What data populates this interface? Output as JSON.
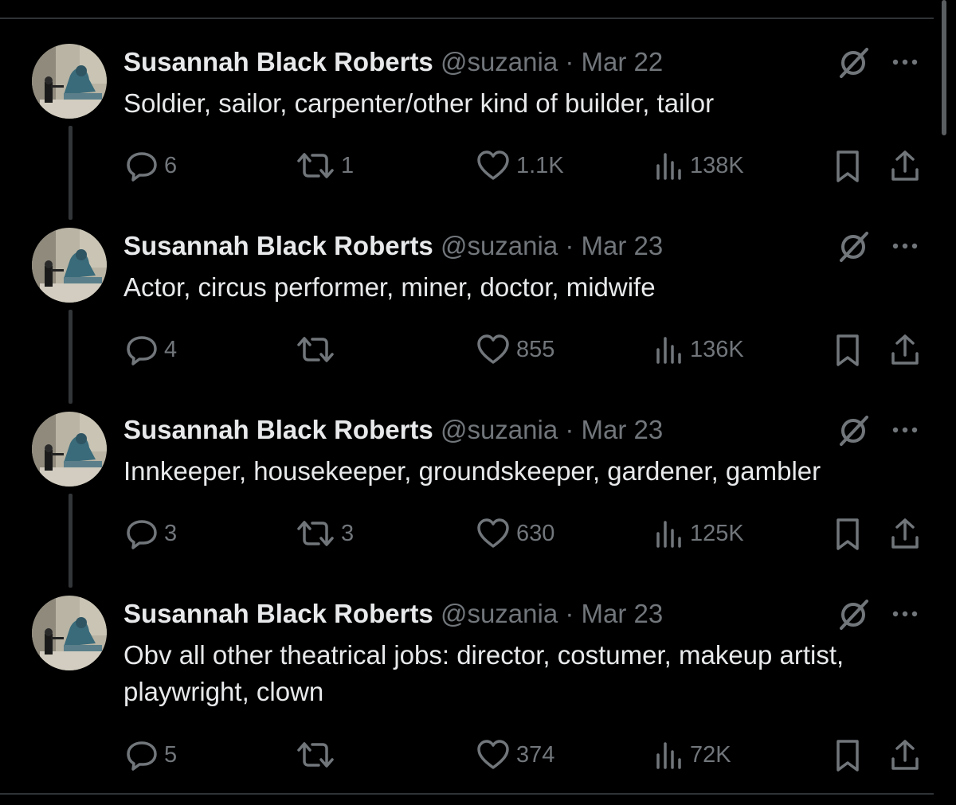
{
  "colors": {
    "background": "#000000",
    "primary_text": "#e7e9ea",
    "secondary_text": "#71767b",
    "divider": "#2f3336"
  },
  "tweets": [
    {
      "display_name": "Susannah Black Roberts",
      "handle": "@suzania",
      "separator": "·",
      "date": "Mar 22",
      "text": "Soldier, sailor, carpenter/other kind of builder, tailor",
      "replies": "6",
      "reposts": "1",
      "likes": "1.1K",
      "views": "138K"
    },
    {
      "display_name": "Susannah Black Roberts",
      "handle": "@suzania",
      "separator": "·",
      "date": "Mar 23",
      "text": "Actor, circus performer, miner, doctor, midwife",
      "replies": "4",
      "reposts": "",
      "likes": "855",
      "views": "136K"
    },
    {
      "display_name": "Susannah Black Roberts",
      "handle": "@suzania",
      "separator": "·",
      "date": "Mar 23",
      "text": "Innkeeper, housekeeper, groundskeeper, gardener, gambler",
      "replies": "3",
      "reposts": "3",
      "likes": "630",
      "views": "125K"
    },
    {
      "display_name": "Susannah Black Roberts",
      "handle": "@suzania",
      "separator": "·",
      "date": "Mar 23",
      "text": "Obv all other theatrical jobs: director, costumer, makeup artist, playwright, clown",
      "replies": "5",
      "reposts": "",
      "likes": "374",
      "views": "72K"
    }
  ],
  "icons": {
    "grok": "grok-icon",
    "more": "more-icon",
    "reply": "reply-icon",
    "repost": "repost-icon",
    "like": "like-icon",
    "views": "views-icon",
    "bookmark": "bookmark-icon",
    "share": "share-icon"
  }
}
